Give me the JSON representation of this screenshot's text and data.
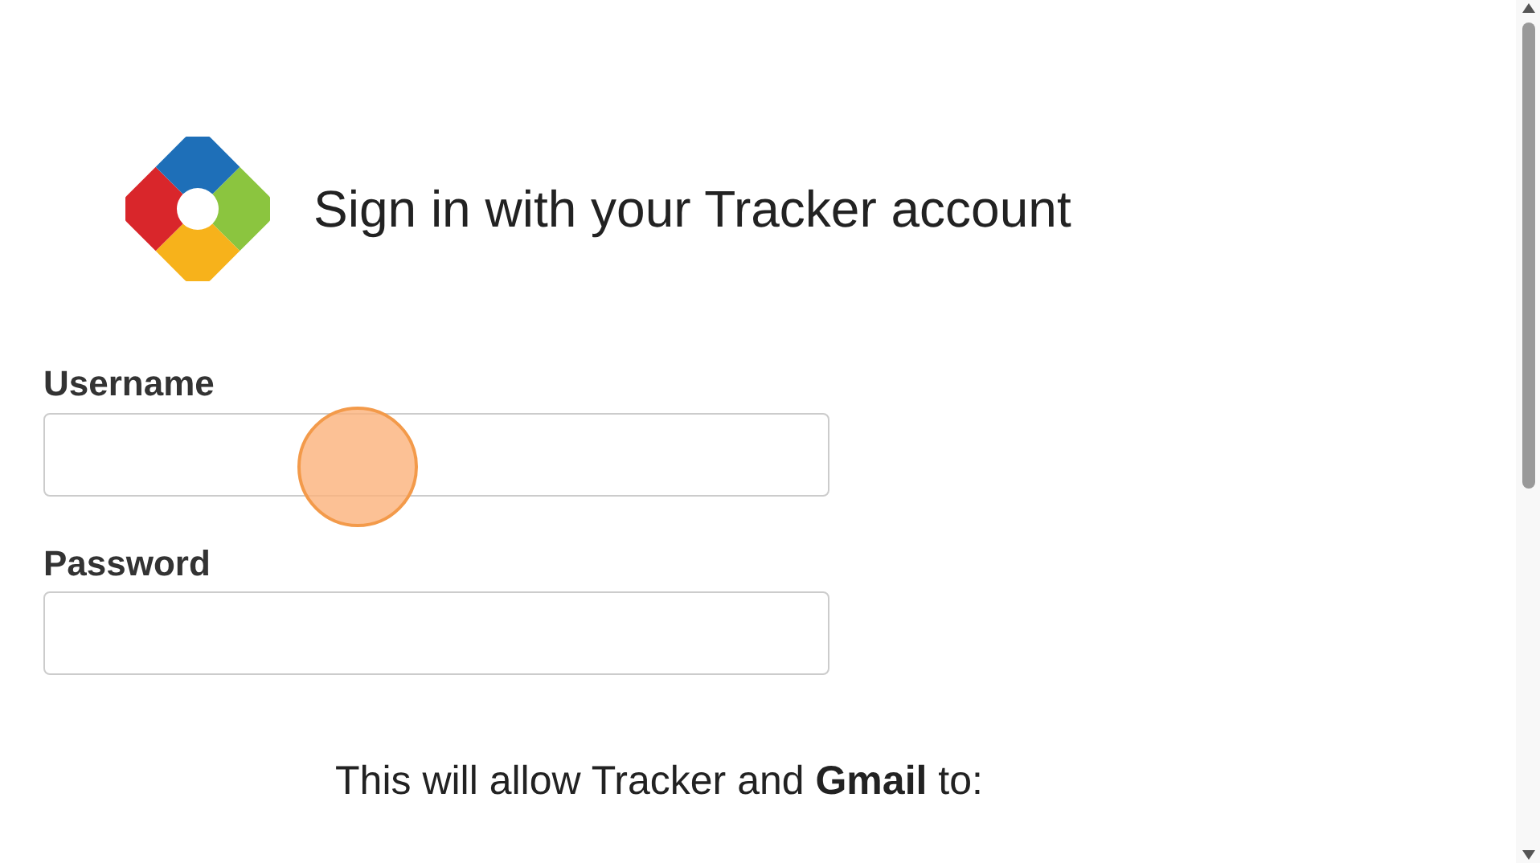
{
  "header": {
    "title": "Sign in with your Tracker account"
  },
  "fields": [
    {
      "label": "Username"
    },
    {
      "label": "Password"
    }
  ],
  "consent": {
    "text": "This will allow Tracker and **Gmail** to:"
  }
}
